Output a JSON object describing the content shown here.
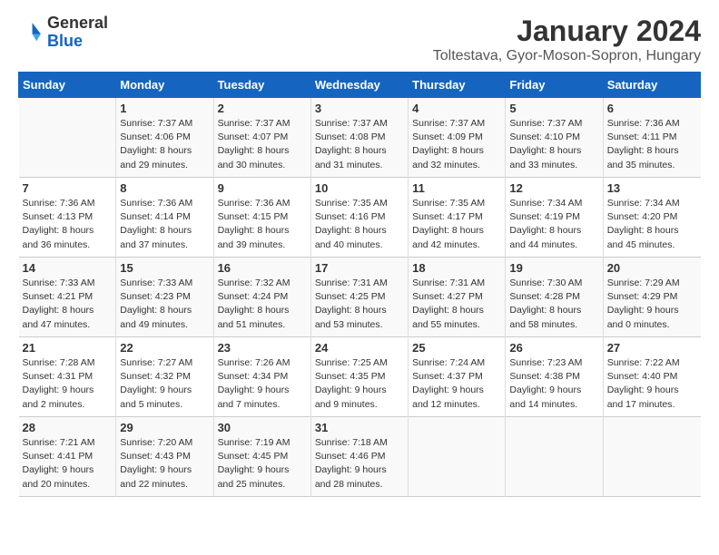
{
  "logo": {
    "general": "General",
    "blue": "Blue"
  },
  "title": "January 2024",
  "location": "Toltestava, Gyor-Moson-Sopron, Hungary",
  "days_of_week": [
    "Sunday",
    "Monday",
    "Tuesday",
    "Wednesday",
    "Thursday",
    "Friday",
    "Saturday"
  ],
  "weeks": [
    [
      {
        "day": "",
        "info": ""
      },
      {
        "day": "1",
        "info": "Sunrise: 7:37 AM\nSunset: 4:06 PM\nDaylight: 8 hours\nand 29 minutes."
      },
      {
        "day": "2",
        "info": "Sunrise: 7:37 AM\nSunset: 4:07 PM\nDaylight: 8 hours\nand 30 minutes."
      },
      {
        "day": "3",
        "info": "Sunrise: 7:37 AM\nSunset: 4:08 PM\nDaylight: 8 hours\nand 31 minutes."
      },
      {
        "day": "4",
        "info": "Sunrise: 7:37 AM\nSunset: 4:09 PM\nDaylight: 8 hours\nand 32 minutes."
      },
      {
        "day": "5",
        "info": "Sunrise: 7:37 AM\nSunset: 4:10 PM\nDaylight: 8 hours\nand 33 minutes."
      },
      {
        "day": "6",
        "info": "Sunrise: 7:36 AM\nSunset: 4:11 PM\nDaylight: 8 hours\nand 35 minutes."
      }
    ],
    [
      {
        "day": "7",
        "info": "Sunrise: 7:36 AM\nSunset: 4:13 PM\nDaylight: 8 hours\nand 36 minutes."
      },
      {
        "day": "8",
        "info": "Sunrise: 7:36 AM\nSunset: 4:14 PM\nDaylight: 8 hours\nand 37 minutes."
      },
      {
        "day": "9",
        "info": "Sunrise: 7:36 AM\nSunset: 4:15 PM\nDaylight: 8 hours\nand 39 minutes."
      },
      {
        "day": "10",
        "info": "Sunrise: 7:35 AM\nSunset: 4:16 PM\nDaylight: 8 hours\nand 40 minutes."
      },
      {
        "day": "11",
        "info": "Sunrise: 7:35 AM\nSunset: 4:17 PM\nDaylight: 8 hours\nand 42 minutes."
      },
      {
        "day": "12",
        "info": "Sunrise: 7:34 AM\nSunset: 4:19 PM\nDaylight: 8 hours\nand 44 minutes."
      },
      {
        "day": "13",
        "info": "Sunrise: 7:34 AM\nSunset: 4:20 PM\nDaylight: 8 hours\nand 45 minutes."
      }
    ],
    [
      {
        "day": "14",
        "info": "Sunrise: 7:33 AM\nSunset: 4:21 PM\nDaylight: 8 hours\nand 47 minutes."
      },
      {
        "day": "15",
        "info": "Sunrise: 7:33 AM\nSunset: 4:23 PM\nDaylight: 8 hours\nand 49 minutes."
      },
      {
        "day": "16",
        "info": "Sunrise: 7:32 AM\nSunset: 4:24 PM\nDaylight: 8 hours\nand 51 minutes."
      },
      {
        "day": "17",
        "info": "Sunrise: 7:31 AM\nSunset: 4:25 PM\nDaylight: 8 hours\nand 53 minutes."
      },
      {
        "day": "18",
        "info": "Sunrise: 7:31 AM\nSunset: 4:27 PM\nDaylight: 8 hours\nand 55 minutes."
      },
      {
        "day": "19",
        "info": "Sunrise: 7:30 AM\nSunset: 4:28 PM\nDaylight: 8 hours\nand 58 minutes."
      },
      {
        "day": "20",
        "info": "Sunrise: 7:29 AM\nSunset: 4:29 PM\nDaylight: 9 hours\nand 0 minutes."
      }
    ],
    [
      {
        "day": "21",
        "info": "Sunrise: 7:28 AM\nSunset: 4:31 PM\nDaylight: 9 hours\nand 2 minutes."
      },
      {
        "day": "22",
        "info": "Sunrise: 7:27 AM\nSunset: 4:32 PM\nDaylight: 9 hours\nand 5 minutes."
      },
      {
        "day": "23",
        "info": "Sunrise: 7:26 AM\nSunset: 4:34 PM\nDaylight: 9 hours\nand 7 minutes."
      },
      {
        "day": "24",
        "info": "Sunrise: 7:25 AM\nSunset: 4:35 PM\nDaylight: 9 hours\nand 9 minutes."
      },
      {
        "day": "25",
        "info": "Sunrise: 7:24 AM\nSunset: 4:37 PM\nDaylight: 9 hours\nand 12 minutes."
      },
      {
        "day": "26",
        "info": "Sunrise: 7:23 AM\nSunset: 4:38 PM\nDaylight: 9 hours\nand 14 minutes."
      },
      {
        "day": "27",
        "info": "Sunrise: 7:22 AM\nSunset: 4:40 PM\nDaylight: 9 hours\nand 17 minutes."
      }
    ],
    [
      {
        "day": "28",
        "info": "Sunrise: 7:21 AM\nSunset: 4:41 PM\nDaylight: 9 hours\nand 20 minutes."
      },
      {
        "day": "29",
        "info": "Sunrise: 7:20 AM\nSunset: 4:43 PM\nDaylight: 9 hours\nand 22 minutes."
      },
      {
        "day": "30",
        "info": "Sunrise: 7:19 AM\nSunset: 4:45 PM\nDaylight: 9 hours\nand 25 minutes."
      },
      {
        "day": "31",
        "info": "Sunrise: 7:18 AM\nSunset: 4:46 PM\nDaylight: 9 hours\nand 28 minutes."
      },
      {
        "day": "",
        "info": ""
      },
      {
        "day": "",
        "info": ""
      },
      {
        "day": "",
        "info": ""
      }
    ]
  ]
}
